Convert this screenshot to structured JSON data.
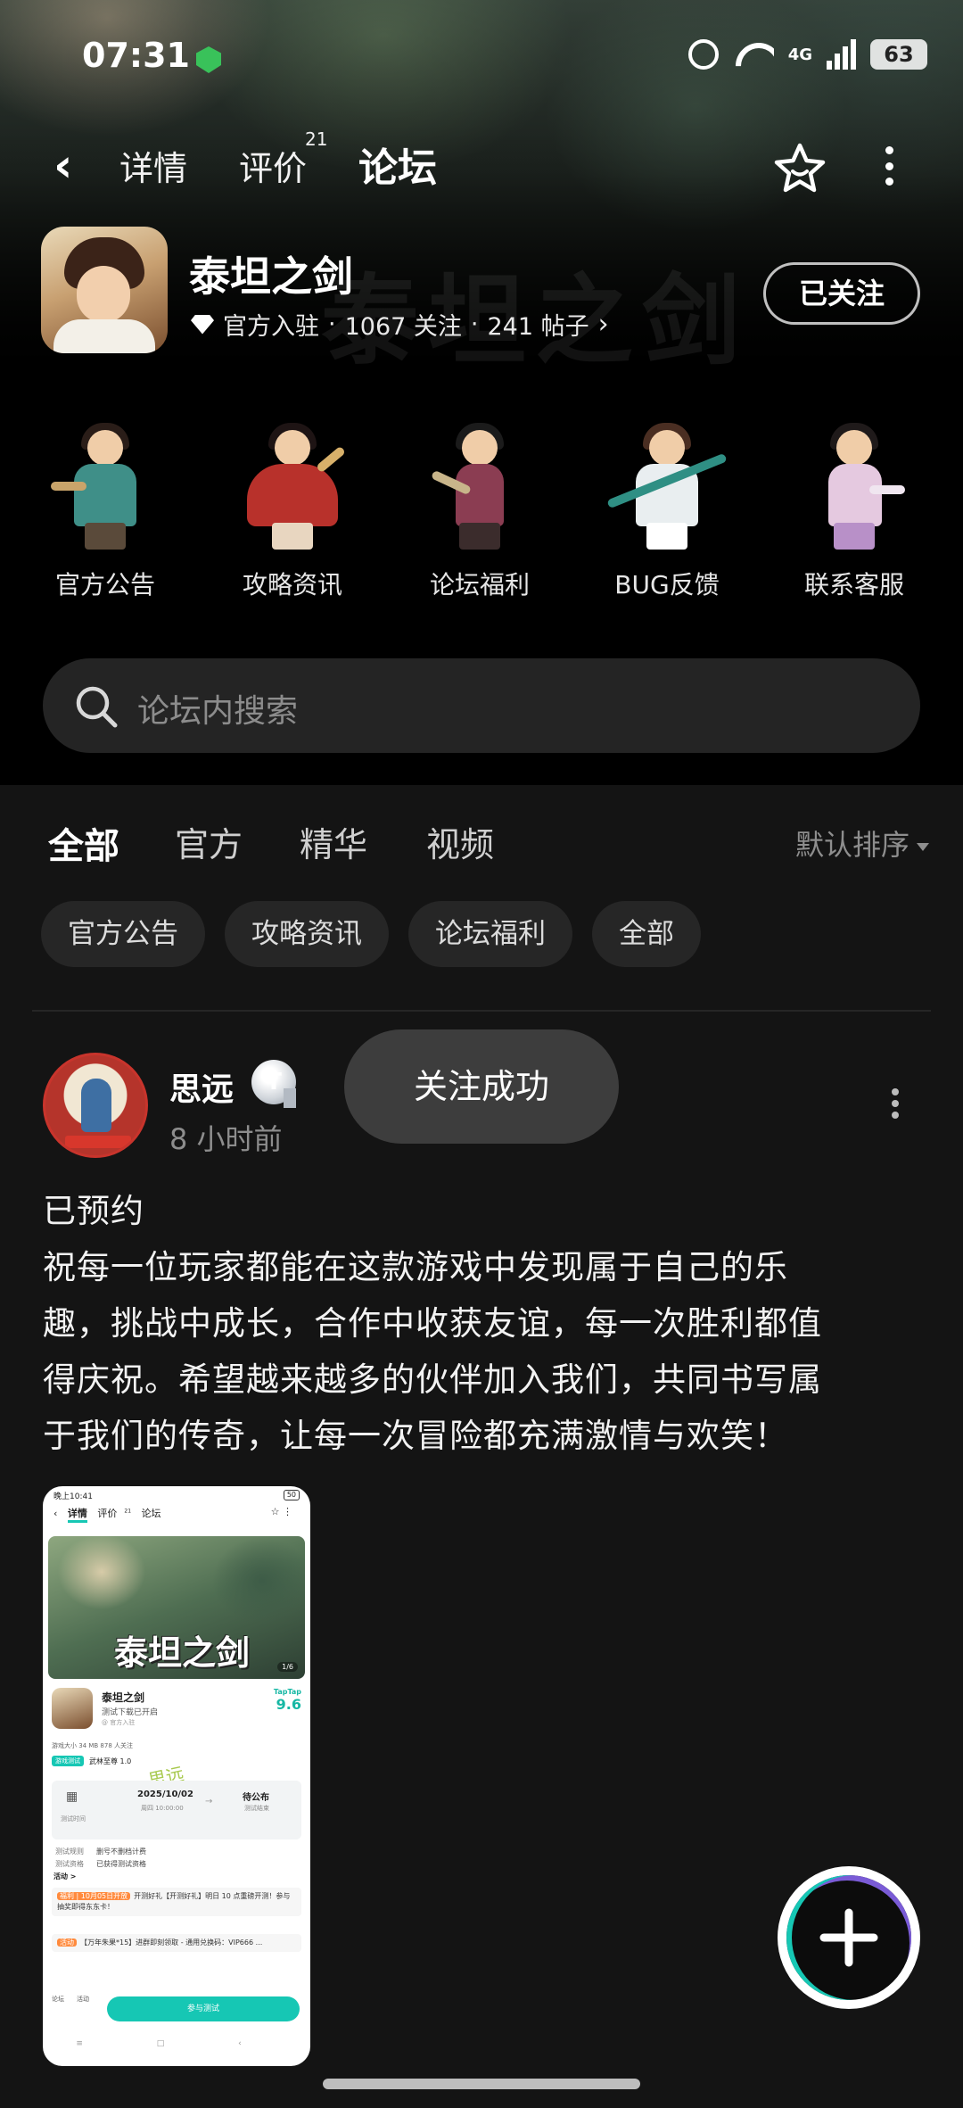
{
  "status_bar": {
    "time": "07:31",
    "network": "4G",
    "battery": "63"
  },
  "nav": {
    "tabs": [
      {
        "label": "详情"
      },
      {
        "label": "评价",
        "count": "21"
      },
      {
        "label": "论坛"
      }
    ]
  },
  "app": {
    "name": "泰坦之剑",
    "official": "官方入驻",
    "followers": "1067 关注",
    "posts": "241 帖子",
    "follow_state": "已关注"
  },
  "categories": [
    {
      "label": "官方公告"
    },
    {
      "label": "攻略资讯"
    },
    {
      "label": "论坛福利"
    },
    {
      "label": "BUG反馈"
    },
    {
      "label": "联系客服"
    }
  ],
  "search": {
    "placeholder": "论坛内搜索"
  },
  "feed_tabs": [
    {
      "label": "全部"
    },
    {
      "label": "官方"
    },
    {
      "label": "精华"
    },
    {
      "label": "视频"
    }
  ],
  "sort": {
    "label": "默认排序"
  },
  "filter_chips": [
    {
      "label": "官方公告"
    },
    {
      "label": "攻略资讯"
    },
    {
      "label": "论坛福利"
    },
    {
      "label": "全部"
    }
  ],
  "post": {
    "author": "思远",
    "badge": "T",
    "time": "8 小时前",
    "toast": "关注成功",
    "lines": [
      "已预约",
      "祝每一位玩家都能在这款游戏中发现属于自己的乐",
      "趣，挑战中成长，合作中收获友谊，每一次胜利都值",
      "得庆祝。希望越来越多的伙伴加入我们，共同书写属",
      "于我们的传奇，让每一次冒险都充满激情与欢笑！"
    ]
  },
  "thumbnail": {
    "status_time": "晚上10:41",
    "status_battery": "50",
    "nav": {
      "detail": "详情",
      "review": "评价",
      "review_count": "21",
      "forum": "论坛"
    },
    "banner_title": "泰坦之剑",
    "page": "1/6",
    "app_name": "泰坦之剑",
    "app_sub": "测试下载已开启",
    "app_sub2": "@ 官方入驻",
    "score_brand": "TapTap",
    "score": "9.6",
    "info": "游戏大小 34 MB     878 人关注",
    "test_tag": "游戏测试",
    "test_name": "武林至尊 1.0",
    "signature": "思远",
    "test_date": "2025/10/02",
    "test_date_sub": "周四  10:00:00",
    "test_left_label": "测试时间",
    "test_end": "待公布",
    "test_end_sub": "测试结束",
    "kv": [
      {
        "k": "测试规则",
        "v": "删号不删档计费"
      },
      {
        "k": "测试资格",
        "v": "已获得测试资格"
      }
    ],
    "activity_title": "活动 >",
    "activity1_tag": "福利 | 10月05日开放",
    "activity1": "开测好礼【开测好礼】明日 10 点重磅开测！参与抽奖即得东东卡！",
    "activity2_tag": "活动",
    "activity2": "【万年朱果*15】进群即刻领取 - 通用兑换码：VIP666 ...",
    "bottom_left": "论坛",
    "bottom_mid": "活动",
    "join_label": "参与测试",
    "sysbar": "≡ □ ‹"
  }
}
